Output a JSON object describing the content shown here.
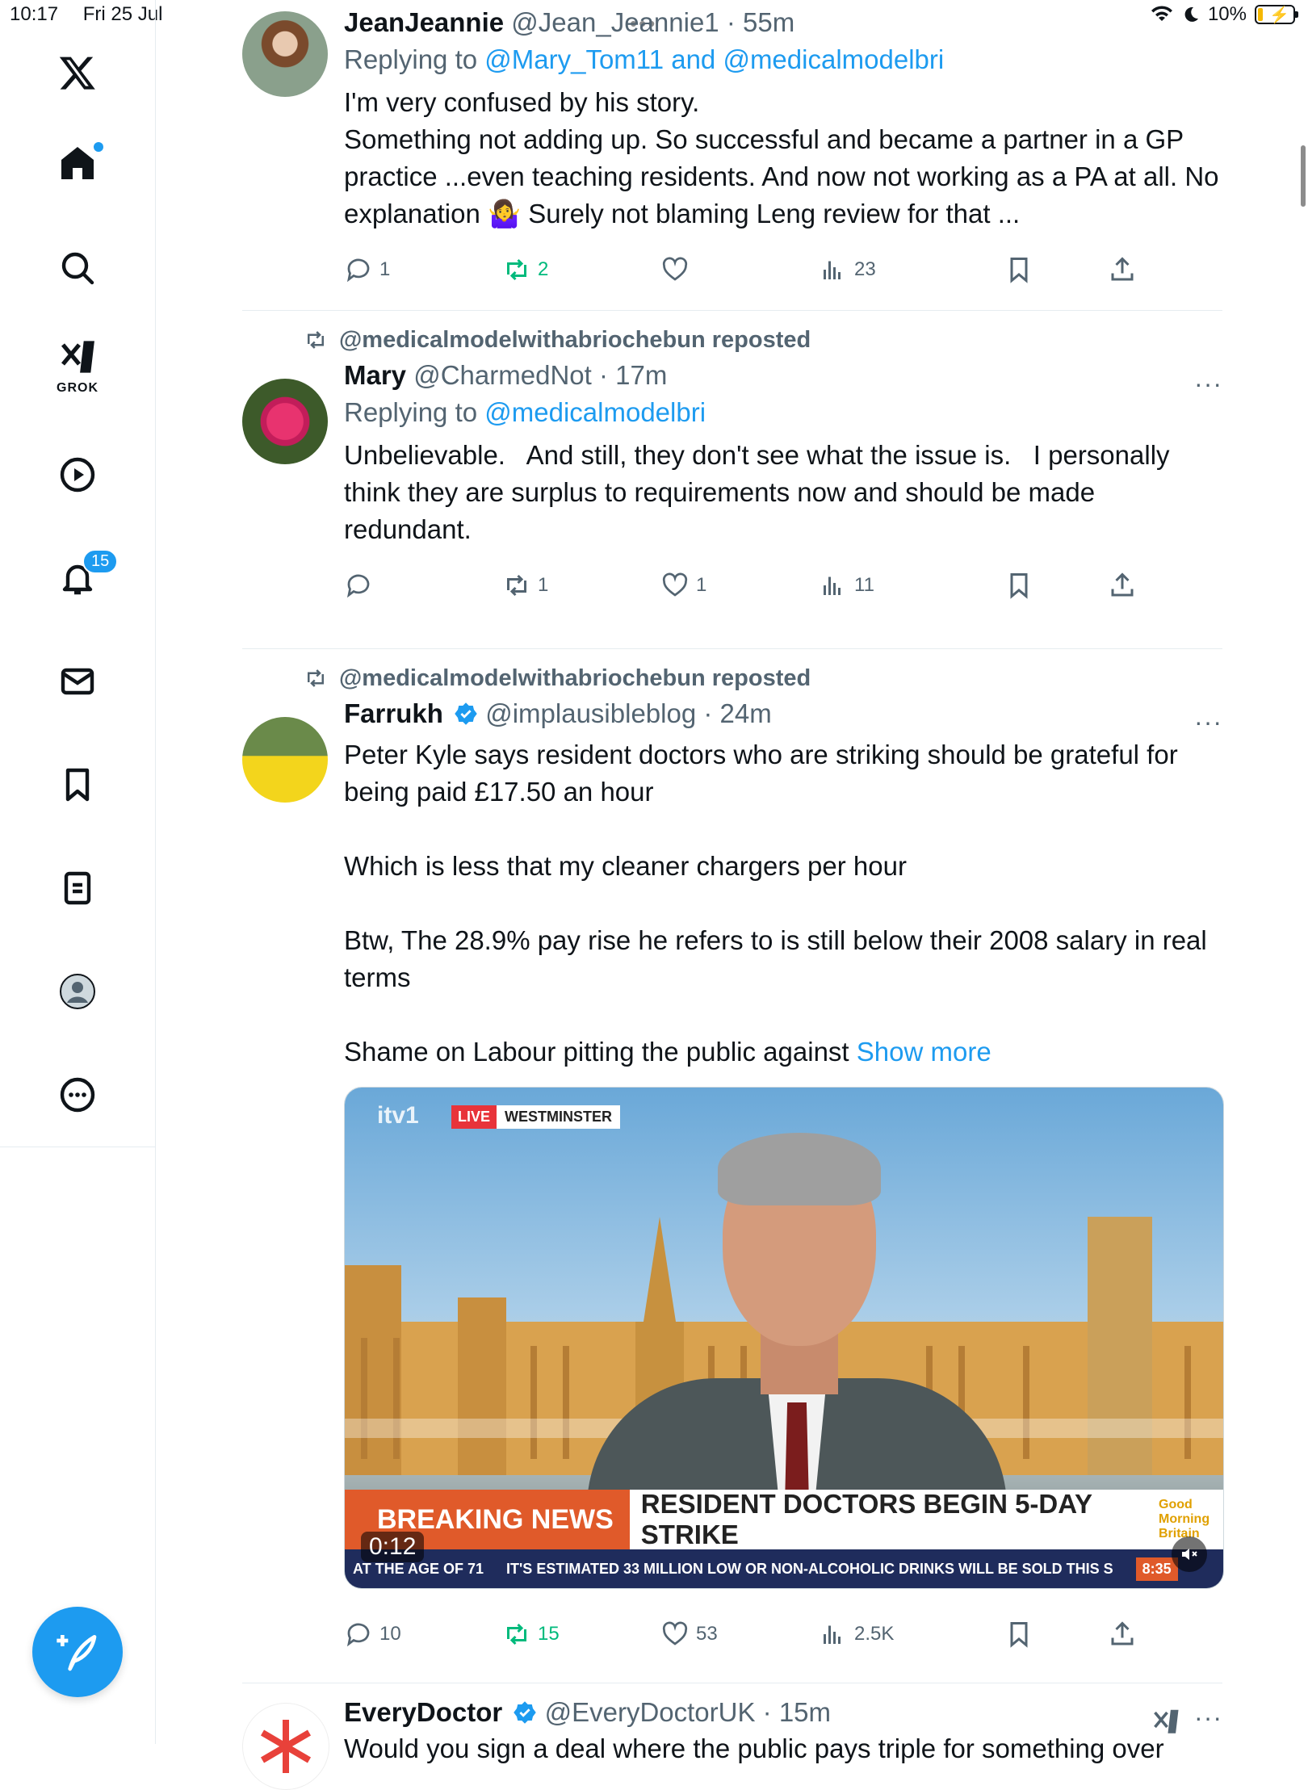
{
  "status_bar": {
    "time": "10:17",
    "date": "Fri 25 Jul",
    "battery": "10%"
  },
  "sidebar": {
    "grok_label": "GROK",
    "notifications_count": "15"
  },
  "tweets": [
    {
      "name": "JeanJeannie",
      "handle": "@Jean_Jeannie1",
      "time": "55m",
      "replying_prefix": "Replying to ",
      "replying_to": "@Mary_Tom11 and @medicalmodelbri",
      "text": "I'm very confused by his story.\nSomething not adding up. So successful and became a partner in a GP practice ...even teaching residents. And now not working as a PA at all. No explanation 🤷‍♀️ Surely not blaming Leng review for that ...",
      "replies": "1",
      "reposts": "2",
      "likes": "",
      "views": "23"
    },
    {
      "reposted_by": "@medicalmodelwithabriochebun reposted",
      "name": "Mary",
      "handle": "@CharmedNot",
      "time": "17m",
      "replying_prefix": "Replying to ",
      "replying_to": "@medicalmodelbri",
      "text": "Unbelievable.   And still, they don't see what the issue is.   I personally think they are surplus to requirements now and should be made redundant.",
      "replies": "",
      "reposts": "1",
      "likes": "1",
      "views": "11"
    },
    {
      "reposted_by": "@medicalmodelwithabriochebun reposted",
      "name": "Farrukh",
      "handle": "@implausibleblog",
      "time": "24m",
      "text": "Peter Kyle says resident doctors who are striking should be grateful for being paid £17.50 an hour\n\nWhich is less that my cleaner chargers per hour\n\nBtw, The 28.9% pay rise he refers to is still below their 2008 salary in real terms\n\nShame on Labour pitting the public against ",
      "show_more": "Show more",
      "video": {
        "channel": "itv1",
        "live": "LIVE",
        "location": "WESTMINSTER",
        "breaking": "BREAKING NEWS",
        "headline": "RESIDENT DOCTORS BEGIN 5-DAY STRIKE",
        "gmb": "Good Morning Britain",
        "ticker_1": "AT THE AGE OF 71",
        "ticker_2": "IT'S ESTIMATED 33 MILLION LOW OR NON-ALCOHOLIC DRINKS WILL BE SOLD THIS S",
        "ticker_time": "8:35",
        "timer": "0:12"
      },
      "replies": "10",
      "reposts": "15",
      "likes": "53",
      "views": "2.5K"
    },
    {
      "name": "EveryDoctor",
      "handle": "@EveryDoctorUK",
      "time": "15m",
      "text": "Would you sign a deal where the public pays triple for something over"
    }
  ],
  "colors": {
    "accent": "#1d9bf0",
    "repost_green": "#00ba7c",
    "muted": "#536471"
  }
}
